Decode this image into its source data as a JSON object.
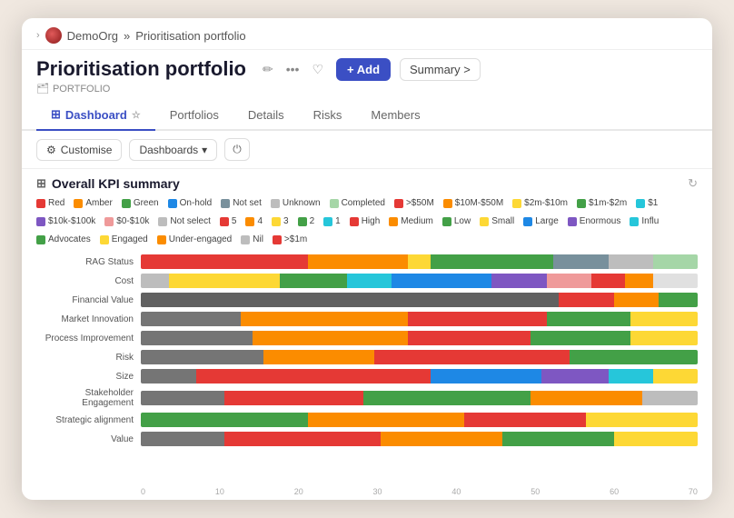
{
  "titlebar": {
    "chevron": "›",
    "org_name": "DemoOrg",
    "separator": "»",
    "page_path": "Prioritisation portfolio"
  },
  "header": {
    "title": "Prioritisation portfolio",
    "portfolio_label": "PORTFOLIO",
    "edit_icon": "✏",
    "more_icon": "•••",
    "bookmark_icon": "♡",
    "add_button": "+ Add",
    "summary_button": "Summary >"
  },
  "tabs": [
    {
      "label": "Dashboard",
      "active": true,
      "icon": "⊞"
    },
    {
      "label": "Portfolios",
      "active": false
    },
    {
      "label": "Details",
      "active": false
    },
    {
      "label": "Risks",
      "active": false
    },
    {
      "label": "Members",
      "active": false
    }
  ],
  "toolbar": {
    "customise_label": "Customise",
    "dashboards_label": "Dashboards",
    "power_icon": "⏻"
  },
  "kpi": {
    "title": "Overall KPI summary",
    "icon": "⊞"
  },
  "legend": [
    {
      "label": "Red",
      "color": "#e53935"
    },
    {
      "label": "Amber",
      "color": "#fb8c00"
    },
    {
      "label": "Green",
      "color": "#43a047"
    },
    {
      "label": "On-hold",
      "color": "#1e88e5"
    },
    {
      "label": "Not set",
      "color": "#78909c"
    },
    {
      "label": "Unknown",
      "color": "#bdbdbd"
    },
    {
      "label": "Completed",
      "color": "#a5d6a7"
    },
    {
      "label": ">$50M",
      "color": "#e53935"
    },
    {
      "label": "$10M-$50M",
      "color": "#fb8c00"
    },
    {
      "label": "$2m-$10m",
      "color": "#fdd835"
    },
    {
      "label": "$1m-$2m",
      "color": "#43a047"
    },
    {
      "label": "$1",
      "color": "#26c6da"
    },
    {
      "label": "$10k-$100k",
      "color": "#7e57c2"
    },
    {
      "label": "$0-$10k",
      "color": "#ef9a9a"
    },
    {
      "label": "Not select",
      "color": "#bdbdbd"
    },
    {
      "label": "5",
      "color": "#e53935"
    },
    {
      "label": "4",
      "color": "#fb8c00"
    },
    {
      "label": "3",
      "color": "#fdd835"
    },
    {
      "label": "2",
      "color": "#43a047"
    },
    {
      "label": "1",
      "color": "#26c6da"
    },
    {
      "label": "High",
      "color": "#e53935"
    },
    {
      "label": "Medium",
      "color": "#fb8c00"
    },
    {
      "label": "Low",
      "color": "#43a047"
    },
    {
      "label": "Small",
      "color": "#fdd835"
    },
    {
      "label": "Large",
      "color": "#1e88e5"
    },
    {
      "label": "Enormous",
      "color": "#7e57c2"
    },
    {
      "label": "Influ",
      "color": "#26c6da"
    },
    {
      "label": "Advocates",
      "color": "#43a047"
    },
    {
      "label": "Engaged",
      "color": "#fdd835"
    },
    {
      "label": "Under-engaged",
      "color": "#fb8c00"
    },
    {
      "label": "Nil",
      "color": "#bdbdbd"
    },
    {
      "label": ">$1m",
      "color": "#e53935"
    }
  ],
  "chart_rows": [
    {
      "label": "RAG Status",
      "segments": [
        {
          "color": "#e53935",
          "pct": 30
        },
        {
          "color": "#fb8c00",
          "pct": 18
        },
        {
          "color": "#fdd835",
          "pct": 4
        },
        {
          "color": "#43a047",
          "pct": 22
        },
        {
          "color": "#78909c",
          "pct": 10
        },
        {
          "color": "#bdbdbd",
          "pct": 8
        },
        {
          "color": "#a5d6a7",
          "pct": 8
        }
      ]
    },
    {
      "label": "Cost",
      "segments": [
        {
          "color": "#bdbdbd",
          "pct": 5
        },
        {
          "color": "#fdd835",
          "pct": 20
        },
        {
          "color": "#43a047",
          "pct": 12
        },
        {
          "color": "#26c6da",
          "pct": 8
        },
        {
          "color": "#1e88e5",
          "pct": 18
        },
        {
          "color": "#7e57c2",
          "pct": 10
        },
        {
          "color": "#ef9a9a",
          "pct": 8
        },
        {
          "color": "#e53935",
          "pct": 6
        },
        {
          "color": "#fb8c00",
          "pct": 5
        },
        {
          "color": "#e0e0e0",
          "pct": 8
        }
      ]
    },
    {
      "label": "Financial Value",
      "segments": [
        {
          "color": "#616161",
          "pct": 75
        },
        {
          "color": "#e53935",
          "pct": 10
        },
        {
          "color": "#fb8c00",
          "pct": 8
        },
        {
          "color": "#43a047",
          "pct": 7
        }
      ]
    },
    {
      "label": "Market Innovation",
      "segments": [
        {
          "color": "#757575",
          "pct": 18
        },
        {
          "color": "#fb8c00",
          "pct": 30
        },
        {
          "color": "#e53935",
          "pct": 25
        },
        {
          "color": "#43a047",
          "pct": 15
        },
        {
          "color": "#fdd835",
          "pct": 12
        }
      ]
    },
    {
      "label": "Process Improvement",
      "segments": [
        {
          "color": "#757575",
          "pct": 20
        },
        {
          "color": "#fb8c00",
          "pct": 28
        },
        {
          "color": "#e53935",
          "pct": 22
        },
        {
          "color": "#43a047",
          "pct": 18
        },
        {
          "color": "#fdd835",
          "pct": 12
        }
      ]
    },
    {
      "label": "Risk",
      "segments": [
        {
          "color": "#757575",
          "pct": 22
        },
        {
          "color": "#fb8c00",
          "pct": 20
        },
        {
          "color": "#e53935",
          "pct": 35
        },
        {
          "color": "#43a047",
          "pct": 23
        }
      ]
    },
    {
      "label": "Size",
      "segments": [
        {
          "color": "#757575",
          "pct": 10
        },
        {
          "color": "#e53935",
          "pct": 42
        },
        {
          "color": "#1e88e5",
          "pct": 20
        },
        {
          "color": "#7e57c2",
          "pct": 12
        },
        {
          "color": "#26c6da",
          "pct": 8
        },
        {
          "color": "#fdd835",
          "pct": 8
        }
      ]
    },
    {
      "label": "Stakeholder Engagement",
      "segments": [
        {
          "color": "#757575",
          "pct": 15
        },
        {
          "color": "#e53935",
          "pct": 25
        },
        {
          "color": "#43a047",
          "pct": 30
        },
        {
          "color": "#fb8c00",
          "pct": 20
        },
        {
          "color": "#bdbdbd",
          "pct": 10
        }
      ]
    },
    {
      "label": "Strategic alignment",
      "segments": [
        {
          "color": "#43a047",
          "pct": 30
        },
        {
          "color": "#fb8c00",
          "pct": 28
        },
        {
          "color": "#e53935",
          "pct": 22
        },
        {
          "color": "#fdd835",
          "pct": 20
        }
      ]
    },
    {
      "label": "Value",
      "segments": [
        {
          "color": "#757575",
          "pct": 15
        },
        {
          "color": "#e53935",
          "pct": 28
        },
        {
          "color": "#fb8c00",
          "pct": 22
        },
        {
          "color": "#43a047",
          "pct": 20
        },
        {
          "color": "#fdd835",
          "pct": 15
        }
      ]
    }
  ],
  "axis": [
    "0",
    "10",
    "20",
    "30",
    "40",
    "50",
    "60",
    "70"
  ]
}
